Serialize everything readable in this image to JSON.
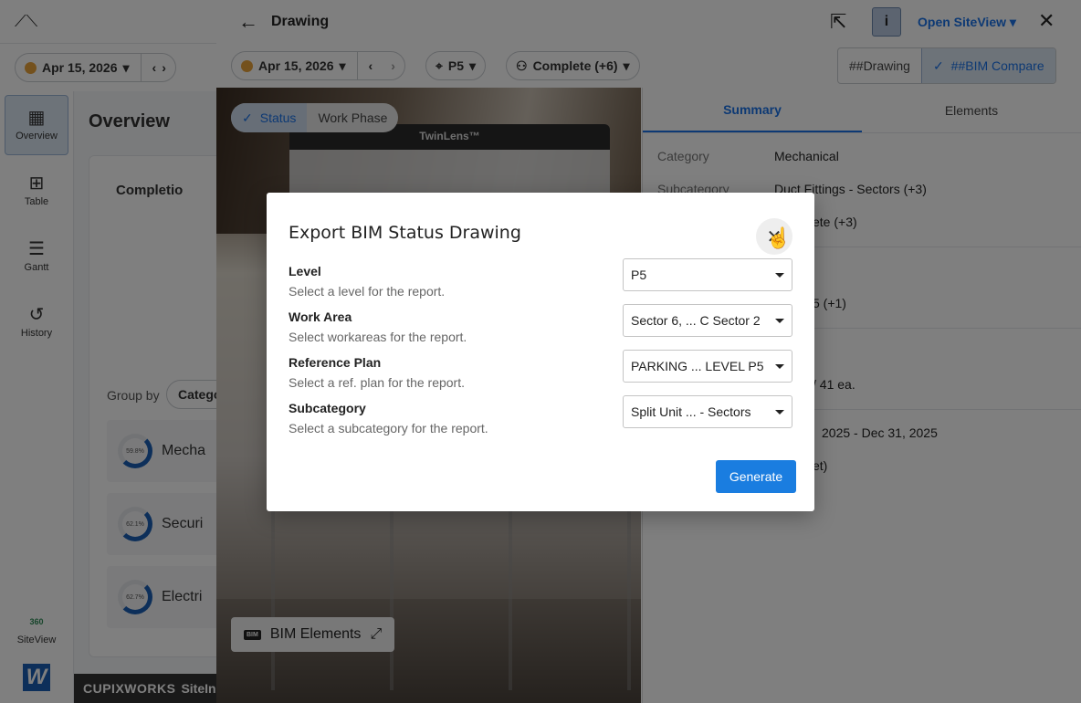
{
  "app": {
    "overview_title": "Overview",
    "date_pill": "Apr 15, 2026",
    "completion_label": "Completio",
    "group_by_label": "Group by",
    "group_by_value": "Catego",
    "group_rows": [
      {
        "pct": "59.8%",
        "label": "Mecha"
      },
      {
        "pct": "62.1%",
        "label": "Securi"
      },
      {
        "pct": "62.7%",
        "label": "Electri"
      }
    ],
    "footer_brand": "CUPIXWORKS",
    "footer_suffix": "SiteIns"
  },
  "sidenav": {
    "items": [
      {
        "label": "Overview",
        "icon": "dashboard-icon"
      },
      {
        "label": "Table",
        "icon": "table-icon"
      },
      {
        "label": "Gantt",
        "icon": "gantt-icon"
      },
      {
        "label": "History",
        "icon": "history-icon"
      }
    ],
    "siteview_label": "SiteView",
    "siteview_badge": "360"
  },
  "drawing": {
    "title": "Drawing",
    "open_siteview": "Open SiteView",
    "date": "Apr 15, 2026",
    "level": "P5",
    "status_filter": "Complete (+6)",
    "view_toggle": [
      "##Drawing",
      "##BIM Compare"
    ],
    "seg_toggle": [
      "Status",
      "Work Phase"
    ],
    "twinlens_label": "TwinLens™",
    "bim_elements": "BIM Elements",
    "bim_tag": "BIM",
    "tabs": [
      "Summary",
      "Elements"
    ],
    "summary": {
      "category_key": "Category",
      "category_value": "Mechanical",
      "subcategory_key": "Subcategory",
      "subcategory_value": "Duct Fittings - Sectors (+3)",
      "frag_1": "ete (+3)",
      "frag_2": "5 (+1)",
      "frag_3": "/ 41 ea.",
      "frag_4": "2025 - Dec 31, 2025",
      "frag_5": "et)"
    }
  },
  "modal": {
    "title": "Export BIM Status Drawing",
    "fields": [
      {
        "label": "Level",
        "help": "Select a level for the report.",
        "value": "P5"
      },
      {
        "label": "Work Area",
        "help": "Select workareas for the report.",
        "value": "Sector 6, ... C Sector 2"
      },
      {
        "label": "Reference Plan",
        "help": "Select a ref. plan for the report.",
        "value": "PARKING ... LEVEL P5"
      },
      {
        "label": "Subcategory",
        "help": "Select a subcategory for the report.",
        "value": "Split Unit ... - Sectors"
      }
    ],
    "generate_label": "Generate"
  },
  "colors": {
    "accent": "#1a7de0",
    "overlay": "rgba(0,0,0,0.5)"
  }
}
